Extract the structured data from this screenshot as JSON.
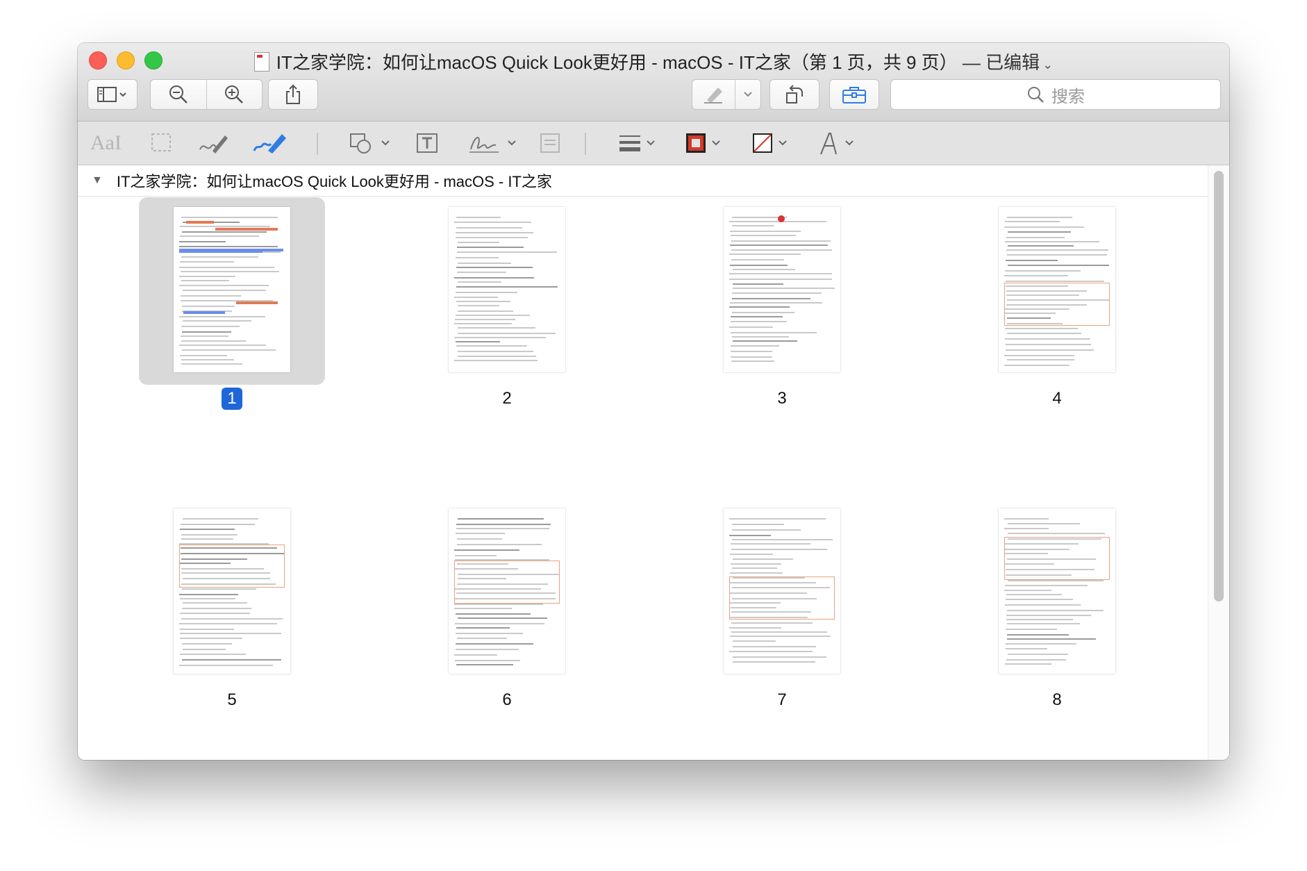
{
  "window": {
    "title": "IT之家学院：如何让macOS Quick Look更好用 - macOS - IT之家（第 1 页，共 9 页）",
    "title_suffix": "— 已编辑",
    "title_chevron": "⌄"
  },
  "toolbar": {
    "search_placeholder": "搜索",
    "buttons": [
      "sidebar-view",
      "zoom-out",
      "zoom-in",
      "share",
      "highlight",
      "rotate",
      "markup-toolbox"
    ]
  },
  "markup": {
    "text_sample": "AaI",
    "tools": [
      "text-selection",
      "rect-selection",
      "sketch",
      "draw",
      "shapes",
      "text",
      "sign",
      "note",
      "line-style",
      "border-color",
      "fill-color",
      "text-style"
    ],
    "border_color": "#d23a2a",
    "fill_color": "none"
  },
  "document": {
    "header": "IT之家学院：如何让macOS Quick Look更好用 - macOS - IT之家",
    "disclosure": "▼",
    "pages": [
      {
        "label": "1",
        "selected": true
      },
      {
        "label": "2",
        "selected": false
      },
      {
        "label": "3",
        "selected": false
      },
      {
        "label": "4",
        "selected": false
      },
      {
        "label": "5",
        "selected": false
      },
      {
        "label": "6",
        "selected": false
      },
      {
        "label": "7",
        "selected": false
      },
      {
        "label": "8",
        "selected": false
      }
    ]
  },
  "colors": {
    "selection": "#1f66d8",
    "close": "#fc5f57",
    "minimize": "#fdbc2e",
    "maximize": "#33c748"
  }
}
